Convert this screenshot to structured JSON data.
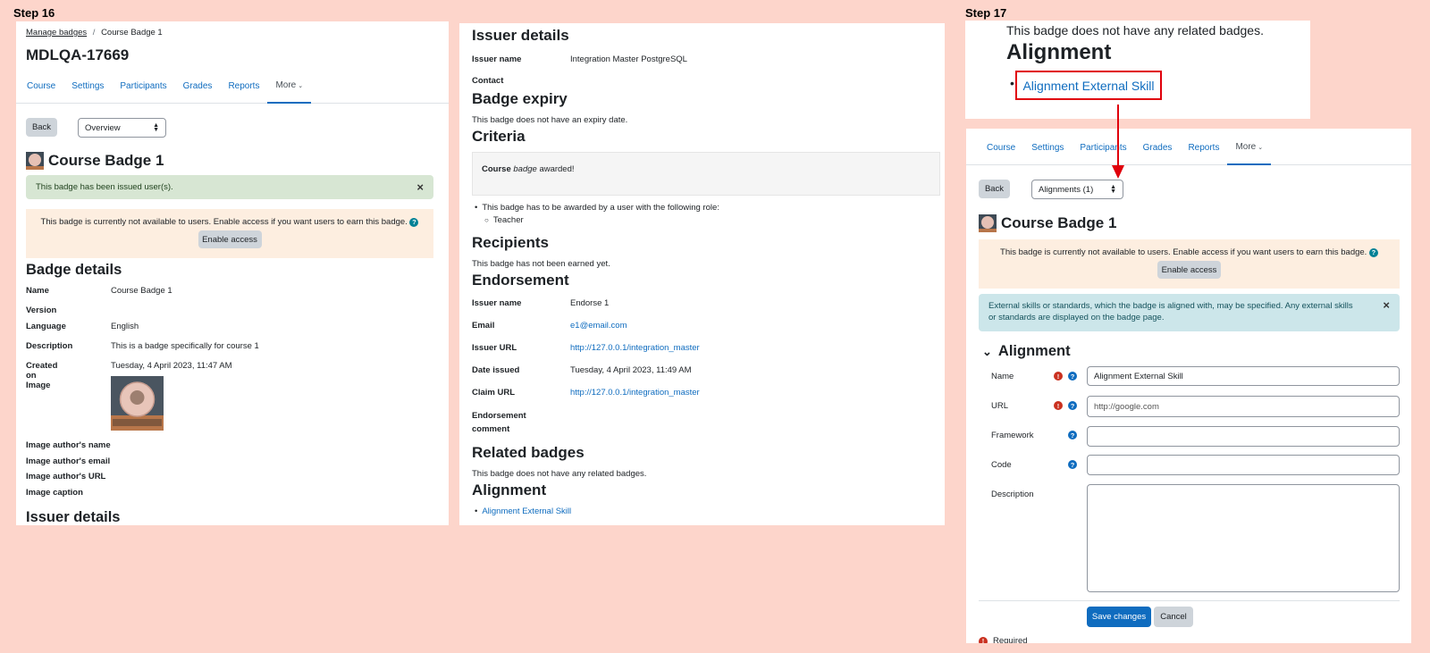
{
  "steps": {
    "step16": "Step 16",
    "step17": "Step 17"
  },
  "panel1": {
    "breadcrumb": {
      "manage": "Manage badges",
      "sep": "/",
      "current": "Course Badge 1"
    },
    "page_title": "MDLQA-17669",
    "tabs": [
      "Course",
      "Settings",
      "Participants",
      "Grades",
      "Reports",
      "More"
    ],
    "back": "Back",
    "select_value": "Overview",
    "badge_title": "Course Badge 1",
    "success_msg": "This badge has been issued user(s).",
    "close": "×",
    "warning_msg": "This badge is currently not available to users. Enable access if you want users to earn this badge.",
    "enable_access": "Enable access",
    "details_heading": "Badge details",
    "details": [
      {
        "label": "Name",
        "value": "Course Badge 1"
      },
      {
        "label": "Version",
        "value": ""
      },
      {
        "label": "Language",
        "value": "English"
      },
      {
        "label": "Description",
        "value": "This is a badge specifically for course 1"
      },
      {
        "label": "Created on",
        "value": "Tuesday, 4 April 2023, 11:47 AM"
      },
      {
        "label": "Image",
        "value": ""
      }
    ],
    "image_meta": [
      "Image author's name",
      "Image author's email",
      "Image author's URL",
      "Image caption"
    ],
    "issuer_heading": "Issuer details"
  },
  "panel2": {
    "issuer_heading": "Issuer details",
    "issuer_name_label": "Issuer name",
    "issuer_name_value": "Integration Master PostgreSQL",
    "contact_label": "Contact",
    "expiry_heading": "Badge expiry",
    "expiry_text": "This badge does not have an expiry date.",
    "criteria_heading": "Criteria",
    "criteria_bold": "Course",
    "criteria_italic": "badge",
    "criteria_rest": "awarded!",
    "criteria_item": "This badge has to be awarded by a user with the following role:",
    "criteria_subitem": "Teacher",
    "recipients_heading": "Recipients",
    "recipients_text": "This badge has not been earned yet.",
    "endorsement_heading": "Endorsement",
    "endorsement": [
      {
        "label": "Issuer name",
        "value": "Endorse 1",
        "link": false
      },
      {
        "label": "Email",
        "value": "e1@email.com",
        "link": true
      },
      {
        "label": "Issuer URL",
        "value": "http://127.0.0.1/integration_master",
        "link": true
      },
      {
        "label": "Date issued",
        "value": "Tuesday, 4 April 2023, 11:49 AM",
        "link": false
      },
      {
        "label": "Claim URL",
        "value": "http://127.0.0.1/integration_master",
        "link": true
      }
    ],
    "endorsement_comment_1": "Endorsement",
    "endorsement_comment_2": "comment",
    "related_heading": "Related badges",
    "related_text": "This badge does not have any related badges.",
    "alignment_heading": "Alignment",
    "alignment_link": "Alignment External Skill"
  },
  "panel3": {
    "related_text": "This badge does not have any related badges.",
    "alignment_heading": "Alignment",
    "alignment_link": "Alignment External Skill"
  },
  "panel4": {
    "tabs": [
      "Course",
      "Settings",
      "Participants",
      "Grades",
      "Reports",
      "More"
    ],
    "back": "Back",
    "select_value": "Alignments (1)",
    "badge_title": "Course Badge 1",
    "warning_msg": "This badge is currently not available to users. Enable access if you want users to earn this badge.",
    "enable_access": "Enable access",
    "info_msg": "External skills or standards, which the badge is aligned with, may be specified. Any external skills or standards are displayed on the badge page.",
    "close": "×",
    "section_heading": "Alignment",
    "fields": [
      {
        "label": "Name",
        "value": "Alignment External Skill",
        "required": true
      },
      {
        "label": "URL",
        "value": "http://google.com",
        "required": true
      },
      {
        "label": "Framework",
        "value": "",
        "required": false
      },
      {
        "label": "Code",
        "value": "",
        "required": false
      }
    ],
    "description_label": "Description",
    "save": "Save changes",
    "cancel": "Cancel",
    "required_label": "Required"
  },
  "colors": {
    "link": "#0f6cbf",
    "annotation": "#e0000b",
    "background": "#fdd5cb"
  }
}
